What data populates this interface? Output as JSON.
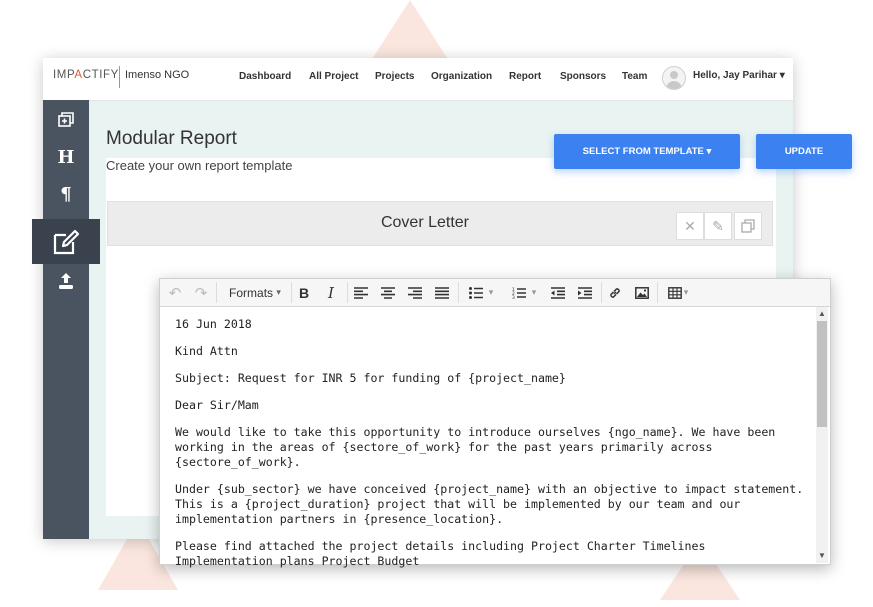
{
  "brand": {
    "logo": "IMPACTIFY",
    "org": "Imenso NGO"
  },
  "nav": {
    "items": [
      "Dashboard",
      "All Project",
      "Projects",
      "Organization",
      "Report",
      "Sponsors",
      "Team"
    ],
    "user": "Hello, Jay Parihar"
  },
  "sidebar": {
    "items": [
      "add-section-icon",
      "heading-icon",
      "paragraph-icon",
      "edit-icon",
      "upload-icon"
    ],
    "active": "edit-icon"
  },
  "page": {
    "title": "Modular Report",
    "subtitle": "Create your own report template",
    "select_template_label": "SELECT FROM TEMPLATE",
    "update_label": "UPDATE"
  },
  "section": {
    "title": "Cover Letter"
  },
  "editor": {
    "formats_label": "Formats",
    "paragraphs": [
      "16 Jun 2018",
      "Kind Attn",
      "Subject: Request for INR 5 for funding of {project_name}",
      "Dear Sir/Mam",
      "We would like to take this opportunity to introduce ourselves {ngo_name}. We have been working in the areas of {sectore_of_work} for the past years primarily across {sectore_of_work}.",
      "Under {sub_sector} we have conceived {project_name} with an objective to impact statement. This is a {project_duration} project that will be implemented by our team and our implementation partners in {presence_location}.",
      "Please find attached the project details including Project Charter Timelines Implementation plans Project Budget"
    ]
  },
  "colors": {
    "accent": "#3b82f0",
    "sidebar": "#4a5460",
    "brand_mark": "#e4572e"
  }
}
